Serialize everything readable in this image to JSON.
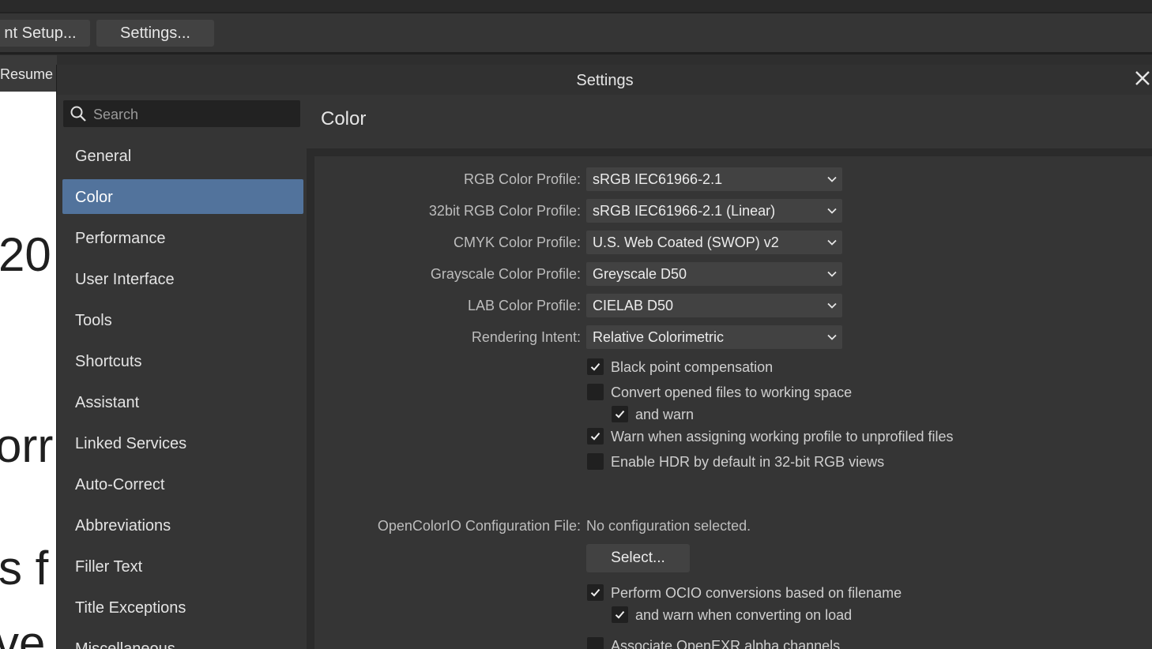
{
  "toolbar": {
    "setup_label": "nt Setup...",
    "settings_label": "Settings..."
  },
  "background_document": {
    "tab_label": "Resume",
    "fragments": [
      "20",
      "orr",
      "s f",
      "ve"
    ]
  },
  "dialog": {
    "title": "Settings",
    "close_icon": "close-icon",
    "search": {
      "placeholder": "Search"
    },
    "nav": {
      "items": [
        {
          "label": "General"
        },
        {
          "label": "Color",
          "active": true
        },
        {
          "label": "Performance"
        },
        {
          "label": "User Interface"
        },
        {
          "label": "Tools"
        },
        {
          "label": "Shortcuts"
        },
        {
          "label": "Assistant"
        },
        {
          "label": "Linked Services"
        },
        {
          "label": "Auto-Correct"
        },
        {
          "label": "Abbreviations"
        },
        {
          "label": "Filler Text"
        },
        {
          "label": "Title Exceptions"
        },
        {
          "label": "Miscellaneous"
        }
      ]
    },
    "section_title": "Color",
    "profiles": [
      {
        "label": "RGB Color Profile:",
        "value": "sRGB IEC61966-2.1"
      },
      {
        "label": "32bit RGB Color Profile:",
        "value": "sRGB IEC61966-2.1 (Linear)"
      },
      {
        "label": "CMYK Color Profile:",
        "value": "U.S. Web Coated (SWOP) v2"
      },
      {
        "label": "Grayscale Color Profile:",
        "value": "Greyscale D50"
      },
      {
        "label": "LAB Color Profile:",
        "value": "CIELAB D50"
      },
      {
        "label": "Rendering Intent:",
        "value": "Relative Colorimetric"
      }
    ],
    "checkboxes": [
      {
        "label": "Black point compensation",
        "checked": true
      },
      {
        "label": "Convert opened files to working space",
        "checked": false
      },
      {
        "label": "and warn",
        "checked": true
      },
      {
        "label": "Warn when assigning working profile to unprofiled files",
        "checked": true
      },
      {
        "label": "Enable HDR by default in 32-bit RGB views",
        "checked": false
      }
    ],
    "ocio": {
      "label": "OpenColorIO Configuration File:",
      "value": "No configuration selected.",
      "select_label": "Select...",
      "checkboxes": [
        {
          "label": "Perform OCIO conversions based on filename",
          "checked": true
        },
        {
          "label": "and warn when converting on load",
          "checked": true
        },
        {
          "label": "Associate OpenEXR alpha channels",
          "checked": false
        }
      ]
    },
    "colors": {
      "accent": "#52739c",
      "background": "#353535",
      "field": "#424242"
    }
  }
}
